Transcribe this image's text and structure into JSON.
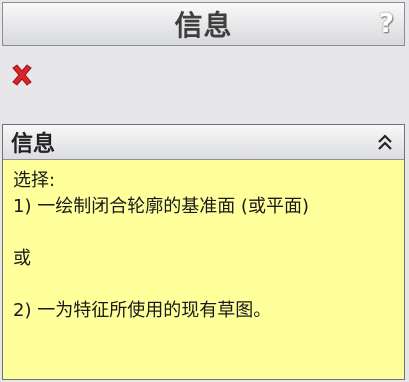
{
  "header": {
    "title": "信息",
    "help_glyph": "?"
  },
  "icons": {
    "help": "question-mark-icon",
    "close": "close-icon",
    "collapse": "double-chevron-up-icon"
  },
  "colors": {
    "message_background": "#ffff9c",
    "close_icon": "#d9262a"
  },
  "message_panel": {
    "title": "信息",
    "lines": [
      "选择:",
      "1) 一绘制闭合轮廓的基准面 (或平面)",
      "",
      "或",
      "",
      "2) 一为特征所使用的现有草图。"
    ]
  }
}
